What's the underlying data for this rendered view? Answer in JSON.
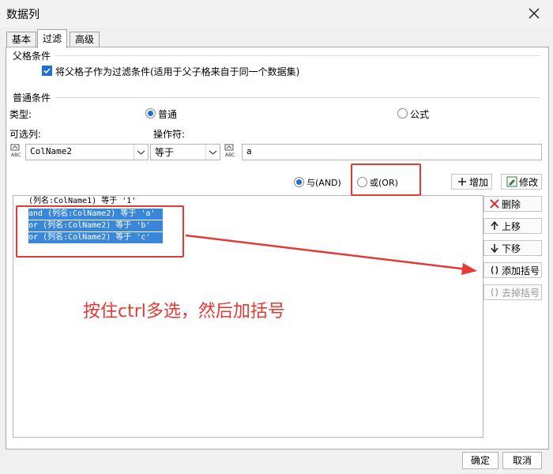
{
  "window": {
    "title": "数据列"
  },
  "tabs": [
    {
      "label": "基本"
    },
    {
      "label": "过滤"
    },
    {
      "label": "高级"
    }
  ],
  "parent_condition": {
    "section_title": "父格条件",
    "checkbox_label": "将父格子作为过滤条件(适用于父子格来自于同一个数据集)",
    "checked": true
  },
  "normal_condition": {
    "section_title": "普通条件",
    "type_label": "类型:",
    "type_options": [
      "普通",
      "公式"
    ],
    "selected_type": "普通",
    "column_label": "可选列:",
    "operator_label": "操作符:",
    "column_value": "ColName2",
    "operator_value": "等于",
    "value_text": "a"
  },
  "logic": {
    "and_label": "与(AND)",
    "or_label": "或(OR)",
    "selected": "and"
  },
  "buttons": {
    "add": "增加",
    "modify": "修改",
    "delete": "删除",
    "up": "上移",
    "down": "下移",
    "add_bracket": "添加括号",
    "remove_bracket": "去掉括号",
    "ok": "确定",
    "cancel": "取消"
  },
  "conditions": [
    {
      "text": "(列名:ColName1) 等于 '1'",
      "selected": false
    },
    {
      "text": "and (列名:ColName2) 等于 'a'",
      "selected": true
    },
    {
      "text": "or  (列名:ColName2) 等于 'b'",
      "selected": true
    },
    {
      "text": "or  (列名:ColName2) 等于 'c'",
      "selected": true
    }
  ],
  "annotation": {
    "text": "按住ctrl多选，然后加括号",
    "color": "#e53935"
  },
  "colors": {
    "accent": "#1e6fd6",
    "selection": "#3a87d9",
    "annotation": "#e53935"
  },
  "icons": [
    "close-icon",
    "checkbox-check-icon",
    "abc-field-icon",
    "chevron-down-icon",
    "plus-icon",
    "edit-icon",
    "delete-x-icon",
    "arrow-up-icon",
    "arrow-down-icon",
    "bracket-icon"
  ]
}
